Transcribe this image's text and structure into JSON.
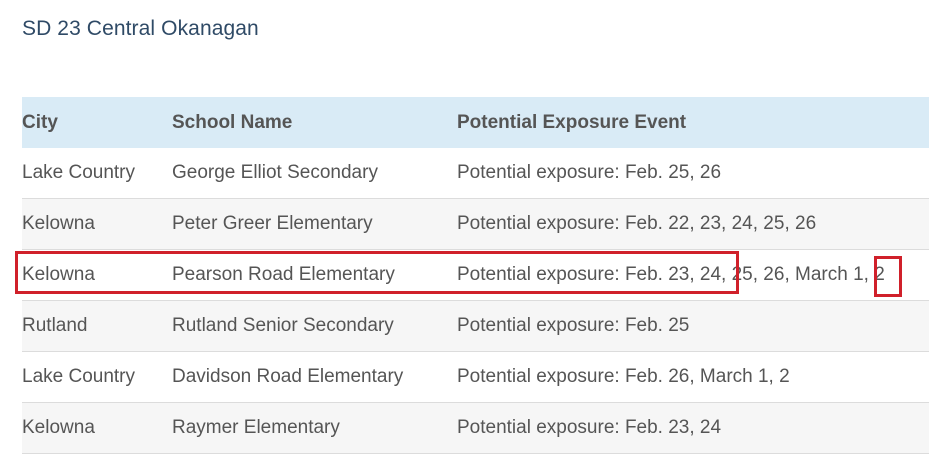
{
  "heading": "SD 23 Central Okanagan",
  "table": {
    "headers": [
      "City",
      "School Name",
      "Potential Exposure Event"
    ],
    "rows": [
      [
        "Lake Country",
        "George Elliot Secondary",
        "Potential exposure: Feb. 25, 26"
      ],
      [
        "Kelowna",
        "Peter Greer Elementary",
        "Potential exposure: Feb. 22, 23, 24, 25, 26"
      ],
      [
        "Kelowna",
        "Pearson Road Elementary",
        "Potential exposure: Feb. 23, 24, 25, 26, March 1, 2"
      ],
      [
        "Rutland",
        "Rutland Senior Secondary",
        "Potential exposure: Feb. 25"
      ],
      [
        "Lake Country",
        "Davidson Road Elementary",
        "Potential exposure: Feb. 26, March 1, 2"
      ],
      [
        "Kelowna",
        "Raymer Elementary",
        "Potential exposure: Feb. 23, 24"
      ]
    ]
  },
  "annotation_color": "#d0202a",
  "header_bg": "#d9ebf6"
}
